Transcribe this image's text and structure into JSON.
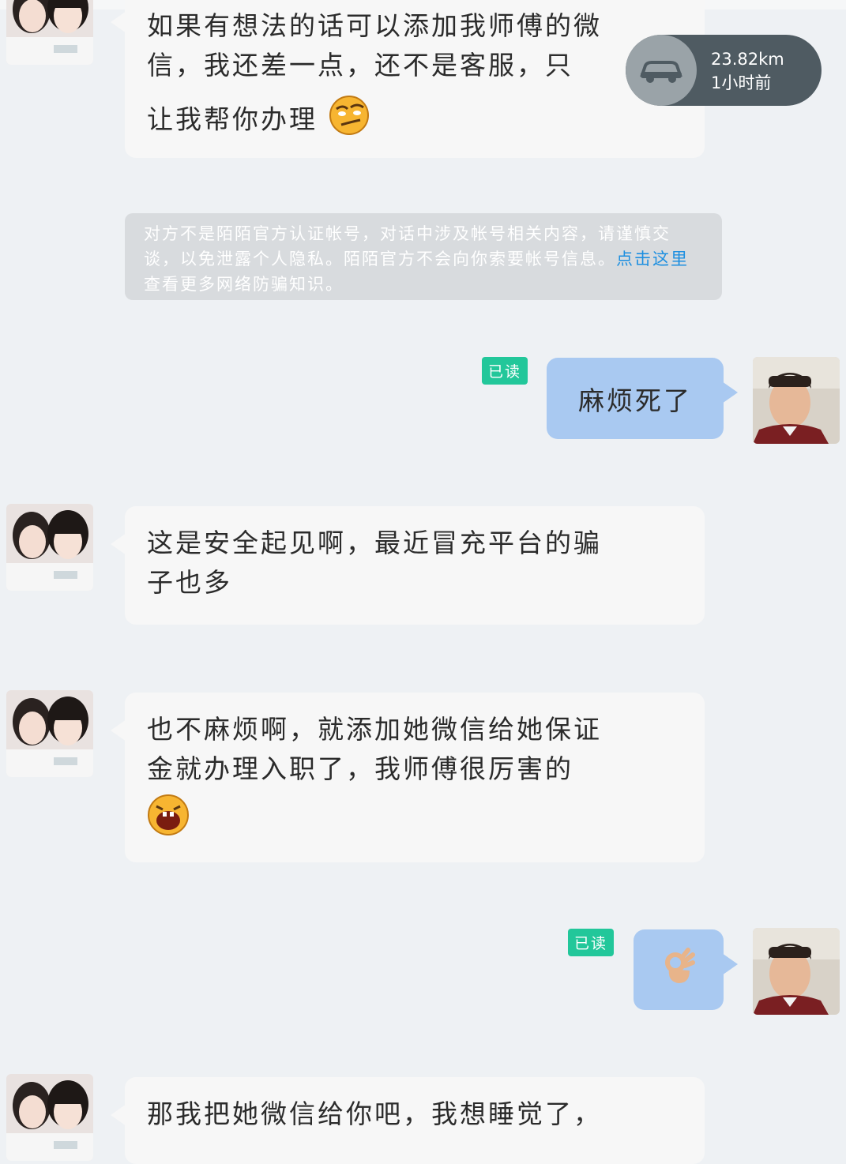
{
  "distance": {
    "value": "23.82km",
    "time": "1小时前",
    "icon": "car-icon"
  },
  "messages": [
    {
      "side": "left",
      "text_lines": [
        "如果有想法的话可以添加我师傅的微",
        "信，我还差一点，还不是客服，只",
        "让我帮你办理"
      ],
      "emoji": "smirk-emoji-icon"
    },
    {
      "side": "notice",
      "text_before": "对方不是陌陌官方认证帐号，对话中涉及帐号相关内容，请谨慎交谈，以免泄露个人隐私。陌陌官方不会向你索要帐号信息。",
      "link": "点击这里",
      "text_after": "查看更多网络防骗知识。"
    },
    {
      "side": "right",
      "read": "已读",
      "text": "麻烦死了"
    },
    {
      "side": "left",
      "text_lines": [
        "这是安全起见啊，最近冒充平台的骗",
        "子也多"
      ]
    },
    {
      "side": "left",
      "text_lines": [
        "也不麻烦啊，就添加她微信给她保证",
        "金就办理入职了，我师傅很厉害的"
      ],
      "emoji": "laughing-emoji-icon"
    },
    {
      "side": "right",
      "read": "已读",
      "emoji": "ok-hand-icon"
    },
    {
      "side": "left",
      "text_lines": [
        "那我把她微信给你吧，我想睡觉了，"
      ]
    }
  ],
  "colors": {
    "background": "#eef1f4",
    "bubble_left": "#f7f7f7",
    "bubble_right": "#a9c9f1",
    "read_badge": "#22c79a",
    "link": "#1d8fe0",
    "notice_bg": "#d8dbde"
  }
}
